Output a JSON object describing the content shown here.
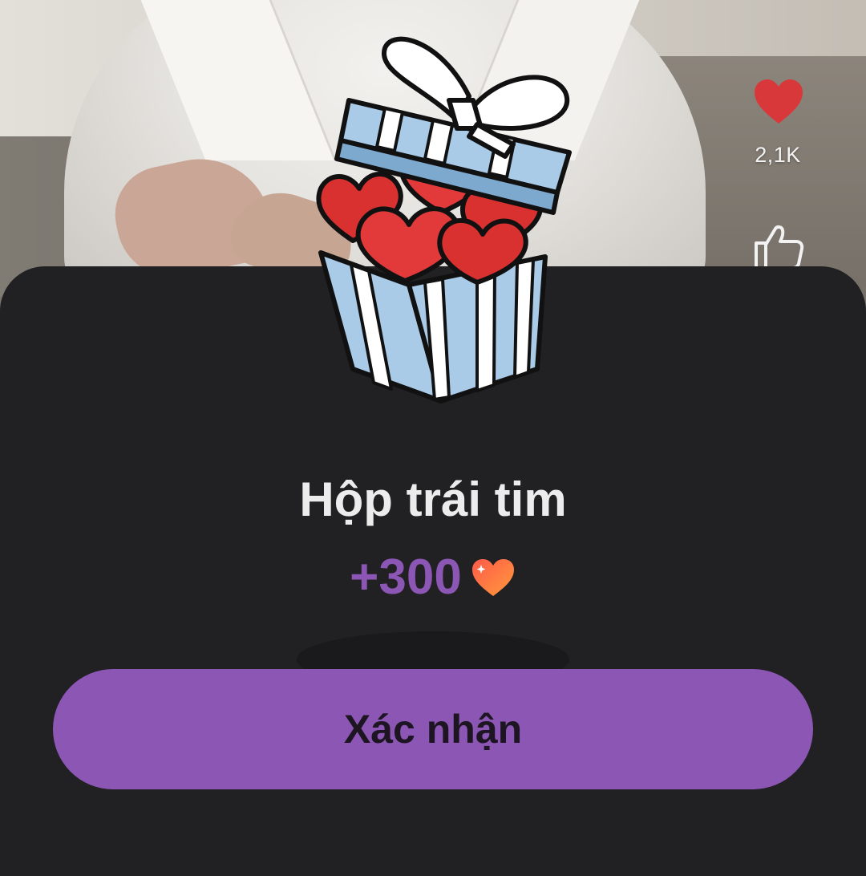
{
  "video": {
    "like_count": "2,1K",
    "like_icon": "heart-icon",
    "thumb_icon": "thumb-up-icon",
    "like_color": "#d9383a"
  },
  "modal": {
    "illustration": "gift-box-hearts-icon",
    "title": "Hộp trái tim",
    "reward_amount": "+300",
    "reward_icon": "heart-icon",
    "confirm_label": "Xác nhận",
    "accent_color": "#8c56b5",
    "background_color": "#212022"
  }
}
